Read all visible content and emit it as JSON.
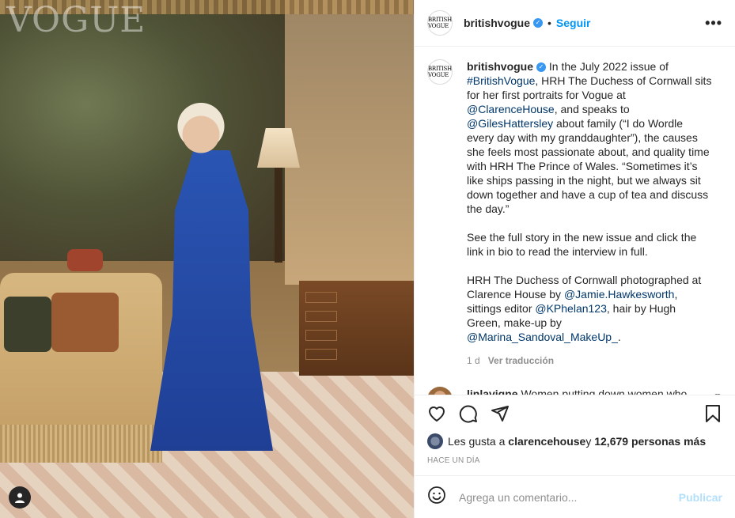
{
  "post": {
    "image": {
      "logo_text": "VOGUE",
      "tag_icon": "user-tag-icon"
    },
    "header": {
      "username": "britishvogue",
      "avatar_text": "BRITISH VOGUE",
      "verified_icon": "verified-badge-icon",
      "dot": "•",
      "follow_label": "Seguir",
      "more_icon": "more-options-icon",
      "more_glyph": "•••"
    },
    "caption": {
      "username": "britishvogue",
      "paragraph1_parts": [
        " In the July 2022 issue of ",
        "#BritishVogue",
        ", HRH The Duchess of Cornwall sits for her first portraits for Vogue at ",
        "@ClarenceHouse",
        ", and speaks to ",
        "@GilesHattersley",
        " about family (“I do Wordle every day with my granddaughter”), the causes she feels most passionate about, and quality time with HRH The Prince of Wales. “Sometimes it’s like ships passing in the night, but we always sit down together and have a cup of tea and discuss the day.”"
      ],
      "paragraph2": "See the full story in the new issue and click the link in bio to read the interview in full.",
      "paragraph3_parts": [
        "HRH The Duchess of Cornwall photographed at Clarence House by ",
        "@Jamie.Hawkesworth",
        ", sittings editor ",
        "@KPhelan123",
        ", hair by Hugh Green, make-up by ",
        "@Marina_Sandoval_MakeUp_",
        "."
      ],
      "age": "1 d",
      "translate_label": "Ver traducción"
    },
    "comments": [
      {
        "username": "linlavigne",
        "text": "Women putting down women who don't even know this lady. Women have a"
      }
    ],
    "actions": {
      "like_icon": "heart-icon",
      "comment_icon": "comment-icon",
      "share_icon": "share-icon",
      "save_icon": "bookmark-icon"
    },
    "likes": {
      "prefix": "Les gusta a ",
      "user": "clarencehouse",
      "middle": " y ",
      "count_text": "12,679 personas más"
    },
    "timestamp": "HACE UN DÍA",
    "add_comment": {
      "emoji_icon": "emoji-icon",
      "placeholder": "Agrega un comentario...",
      "publish_label": "Publicar"
    },
    "colors": {
      "link": "#00376b",
      "follow": "#0095f6",
      "publish_disabled": "#b2dffc",
      "dress": "#2a55b3"
    }
  }
}
